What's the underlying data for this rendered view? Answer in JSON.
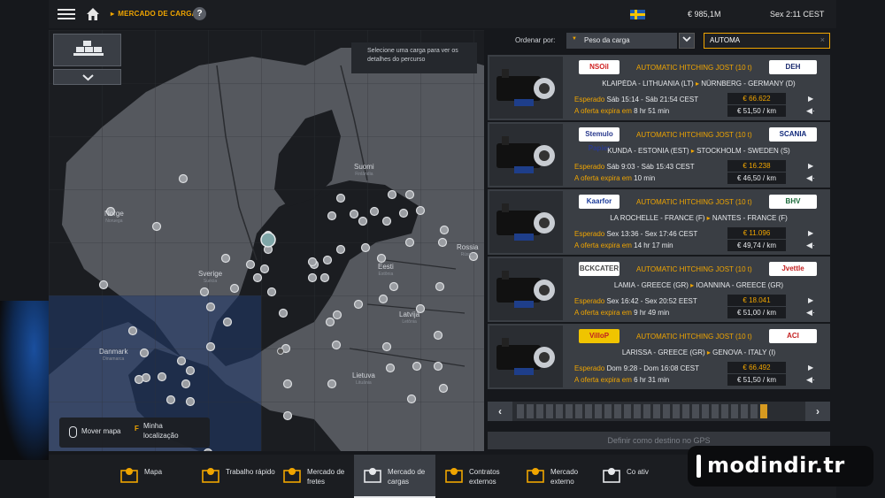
{
  "topbar": {
    "breadcrumb": "MERCADO DE CARGAS",
    "help_label": "?",
    "money": "€ 985,1M",
    "clock": "Sex 2:11 CEST"
  },
  "map": {
    "hint": "Selecione uma carga para ver os detalhes do percurso",
    "labels": [
      {
        "name": "Suomi",
        "sub": "Finlândia"
      },
      {
        "name": "Norge",
        "sub": "Noruega"
      },
      {
        "name": "Sverige",
        "sub": "Suécia"
      },
      {
        "name": "Eesti",
        "sub": "Estônia"
      },
      {
        "name": "Rossia",
        "sub": "Rússia"
      },
      {
        "name": "Latvija",
        "sub": "Letônia"
      },
      {
        "name": "Danmark",
        "sub": "Dinamarca"
      },
      {
        "name": "Lietuva",
        "sub": "Lituânia"
      }
    ],
    "controls": {
      "pan_label": "Mover mapa",
      "key": "F",
      "locate_label": "Minha localização"
    }
  },
  "sort": {
    "label": "Ordenar por:",
    "selected": "Peso da carga",
    "toggle_icon": "chevron-down",
    "search_value": "AUTOMA",
    "search_clear": "×"
  },
  "jobs": [
    {
      "company_from": "NSOil",
      "cargo": "AUTOMATIC HITCHING JOST (10 t)",
      "company_to": "DEH",
      "from": "KLAIPĖDA - LITHUANIA (LT)",
      "to": "NÜRNBERG - GERMANY (D)",
      "expected_label": "Esperado",
      "expected": "Sáb 15:14 - Sáb 21:54 CEST",
      "expire_label": "A oferta expira em",
      "expire": "8 hr 51 min",
      "price": "€ 66.622",
      "rate": "€ 51,50 / km"
    },
    {
      "company_from": "Stemulo Papier",
      "cargo": "AUTOMATIC HITCHING JOST (10 t)",
      "company_to": "SCANIA",
      "from": "KUNDA - ESTONIA (EST)",
      "to": "STOCKHOLM - SWEDEN (S)",
      "expected_label": "Esperado",
      "expected": "Sáb 9:03 - Sáb 15:43 CEST",
      "expire_label": "A oferta expira em",
      "expire": "10 min",
      "price": "€ 16.238",
      "rate": "€ 46,50 / km"
    },
    {
      "company_from": "Kaarfor",
      "cargo": "AUTOMATIC HITCHING JOST (10 t)",
      "company_to": "BHV",
      "from": "LA ROCHELLE - FRANCE (F)",
      "to": "NANTES - FRANCE (F)",
      "expected_label": "Esperado",
      "expected": "Sex 13:36 - Sex 17:46 CEST",
      "expire_label": "A oferta expira em",
      "expire": "14 hr 17 min",
      "price": "€ 11.096",
      "rate": "€ 49,74 / km"
    },
    {
      "company_from": "BCKCATER",
      "cargo": "AUTOMATIC HITCHING JOST (10 t)",
      "company_to": "Jvettle",
      "from": "LAMIA - GREECE (GR)",
      "to": "IOANNINA - GREECE (GR)",
      "expected_label": "Esperado",
      "expected": "Sex 16:42 - Sex 20:52 EEST",
      "expire_label": "A oferta expira em",
      "expire": "9 hr 49 min",
      "price": "€ 18.041",
      "rate": "€ 51,00 / km"
    },
    {
      "company_from": "VilloP",
      "cargo": "AUTOMATIC HITCHING JOST (10 t)",
      "company_to": "ACI",
      "from": "LARISSA - GREECE (GR)",
      "to": "GENOVA - ITALY (I)",
      "expected_label": "Esperado",
      "expected": "Dom 9:28 - Dom 16:08 CEST",
      "expire_label": "A oferta expira em",
      "expire": "6 hr 31 min",
      "price": "€ 66.492",
      "rate": "€ 51,50 / km"
    }
  ],
  "pager": {
    "prev": "‹",
    "next": "›",
    "pages": 26,
    "current": 26
  },
  "gps_button": "Definir como destino no GPS",
  "nav": [
    {
      "label": "Mapa",
      "icon": "map-icon"
    },
    {
      "label": "Trabalho rápido",
      "icon": "stopwatch-icon"
    },
    {
      "label": "Mercado de fretes",
      "icon": "freight-icon"
    },
    {
      "label": "Mercado de cargas",
      "icon": "cargo-icon",
      "active": true
    },
    {
      "label": "Contratos externos",
      "icon": "globe-icon"
    },
    {
      "label": "Mercado externo",
      "icon": "globe-cargo-icon"
    },
    {
      "label": "Co ativ",
      "icon": "search-cargo-icon"
    }
  ],
  "watermark": "modindir.tr",
  "colors": {
    "accent": "#f0a500",
    "panel": "#3a3e44",
    "background": "#16181c"
  }
}
